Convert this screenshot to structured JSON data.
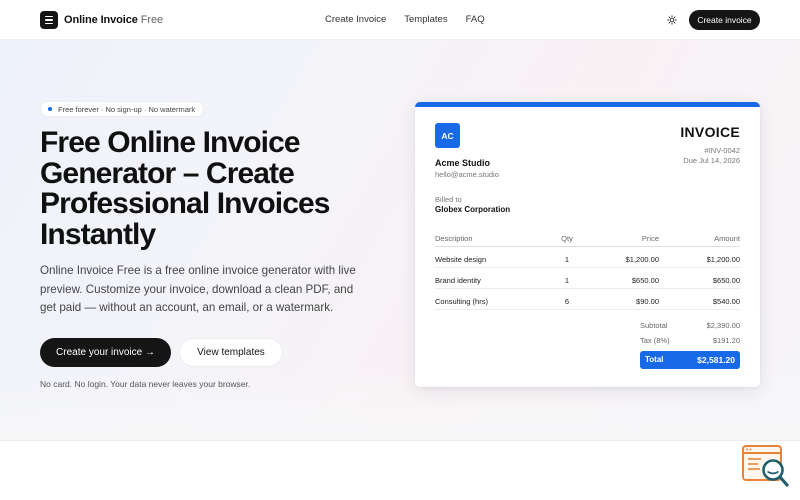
{
  "nav": {
    "brand": "Online Invoice",
    "brand_suffix": "Free",
    "links": [
      "Create Invoice",
      "Templates",
      "FAQ"
    ],
    "theme_icon": "sun-icon",
    "cta_label": "Create invoice"
  },
  "hero": {
    "pill_text": "Free forever · No sign-up · No watermark",
    "title": "Free Online Invoice Generator – Create Professional Invoices Instantly",
    "subtitle": "Online Invoice Free is a free online invoice generator with live preview. Customize your invoice, download a clean PDF, and get paid — without an account, an email, or a watermark.",
    "primary_button": "Create your invoice →",
    "secondary_button": "View templates",
    "note": "No card. No login. Your data never leaves your browser."
  },
  "invoice": {
    "badge": "AC",
    "company": "Acme Studio",
    "email": "hello@acme.studio",
    "title": "INVOICE",
    "number": "#INV-0042",
    "due": "Due Jul 14, 2026",
    "billed_label": "Billed to",
    "billed_name": "Globex Corporation",
    "columns": [
      "Description",
      "Qty",
      "Price",
      "Amount"
    ],
    "rows": [
      {
        "description": "Website design",
        "qty": "1",
        "price": "$1,200.00",
        "amount": "$1,200.00"
      },
      {
        "description": "Brand identity",
        "qty": "1",
        "price": "$650.00",
        "amount": "$650.00"
      },
      {
        "description": "Consulting (hrs)",
        "qty": "6",
        "price": "$90.00",
        "amount": "$540.00"
      }
    ],
    "subtotal_label": "Subtotal",
    "subtotal": "$2,390.00",
    "tax_label": "Tax (8%)",
    "tax": "$191.20",
    "total_label": "Total",
    "total": "$2,581.20"
  },
  "colors": {
    "accent": "#1769e8",
    "dark": "#151515",
    "widget_orange": "#e8833a",
    "widget_teal": "#1f5f6b"
  },
  "widget": {
    "icon": "search-document-icon"
  }
}
